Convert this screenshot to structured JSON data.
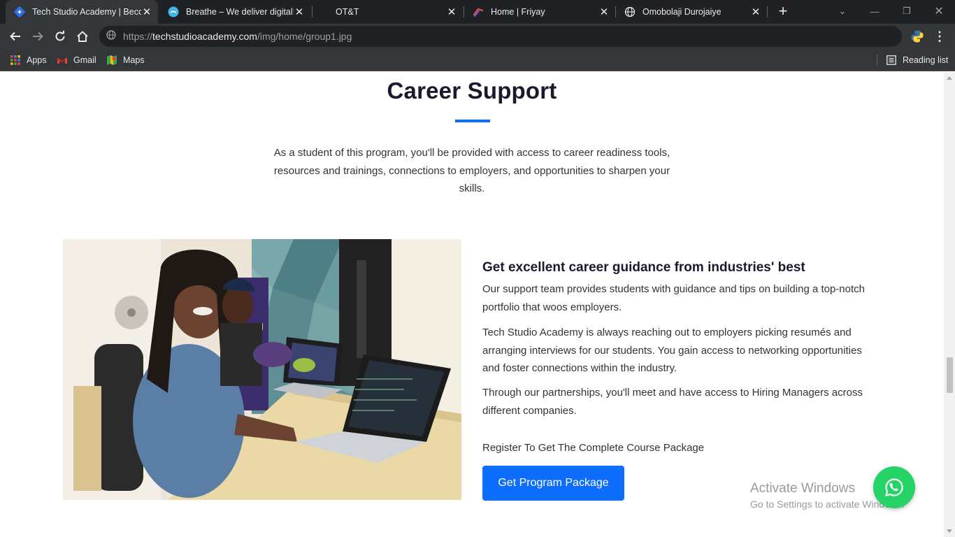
{
  "browser": {
    "tabs": [
      {
        "title": "Tech Studio Academy | Become",
        "favicon": "tech-studio-icon",
        "active": true
      },
      {
        "title": "Breathe – We deliver digital!",
        "favicon": "breathe-icon",
        "active": false
      },
      {
        "title": "OT&T",
        "favicon": "",
        "active": false
      },
      {
        "title": "Home | Friyay",
        "favicon": "friyay-icon",
        "active": false
      },
      {
        "title": "Omobolaji Durojaiye",
        "favicon": "globe-icon",
        "active": false
      }
    ],
    "url": {
      "scheme": "https://",
      "host": "techstudioacademy.com",
      "path": "/img/home/group1.jpg"
    },
    "bookmarks": [
      {
        "label": "Apps",
        "icon": "apps-grid-icon"
      },
      {
        "label": "Gmail",
        "icon": "gmail-icon"
      },
      {
        "label": "Maps",
        "icon": "maps-icon"
      }
    ],
    "reading_list": "Reading list"
  },
  "page": {
    "section_title": "Career Support",
    "intro": "As a student of this program, you'll be provided with access to career readiness tools, resources and trainings, connections to employers, and opportunities to sharpen your skills.",
    "guidance_title": "Get excellent career guidance from industries' best",
    "paragraphs": [
      "Our support team provides students with guidance and tips on building a top-notch portfolio that woos employers.",
      "Tech Studio Academy is always reaching out to employers picking resumés and arranging interviews for our students. You gain access to networking opportunities and foster connections within the industry.",
      "Through our partnerships, you'll meet and have access to Hiring Managers across different companies."
    ],
    "register_text": "Register To Get The Complete Course Package",
    "cta_label": "Get Program Package",
    "accent_color": "#0d6efd"
  },
  "overlay": {
    "activate_title": "Activate Windows",
    "activate_sub": "Go to Settings to activate Windows.",
    "whatsapp_color": "#25d366"
  }
}
